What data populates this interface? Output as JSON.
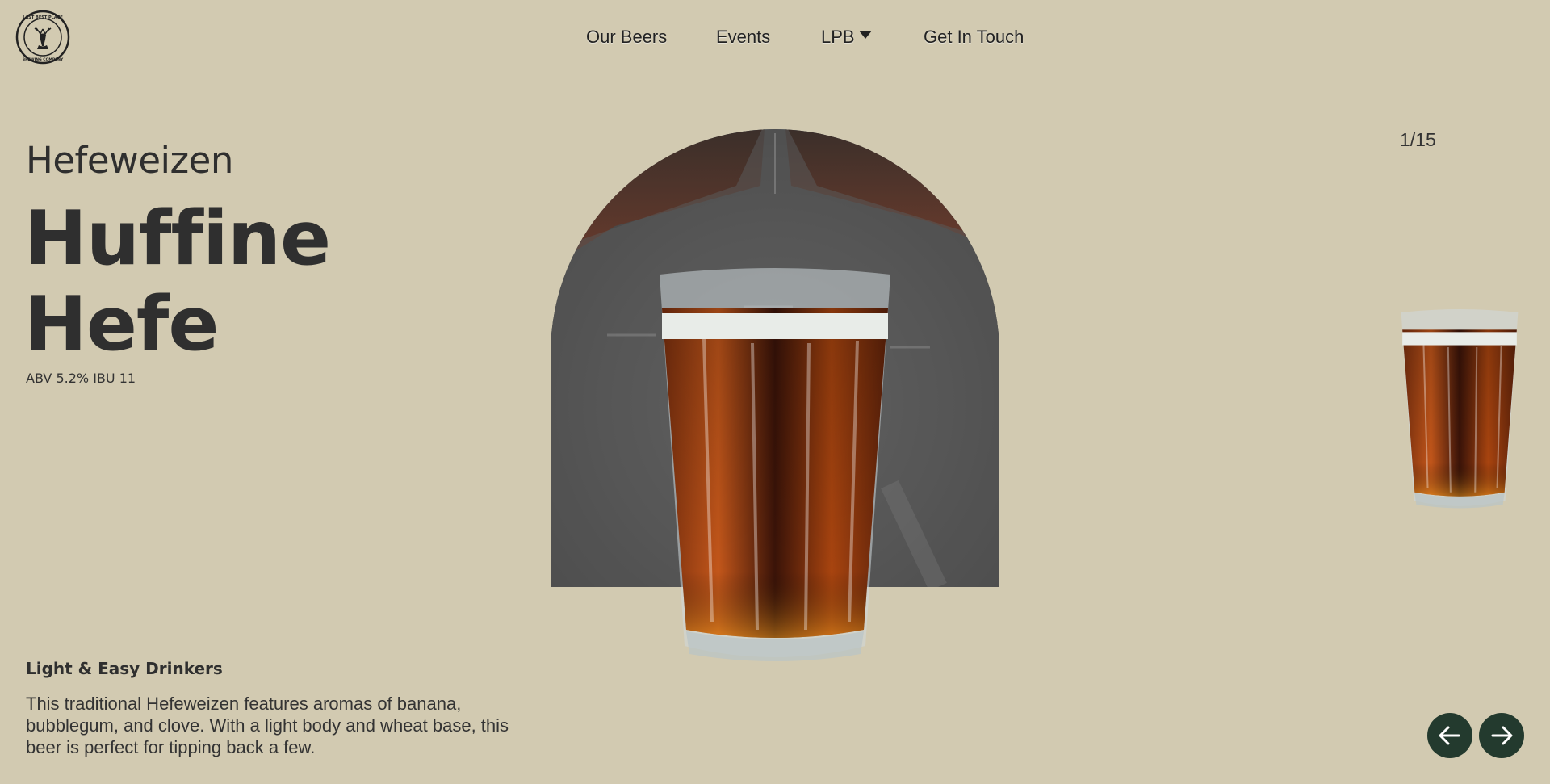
{
  "logo": {
    "text_top": "LAST BEST PLACE",
    "text_bottom": "BREWING COMPANY",
    "icon": "deer-icon"
  },
  "nav": {
    "our_beers": "Our Beers",
    "events": "Events",
    "lpb": "LPB",
    "get_in_touch": "Get In Touch"
  },
  "slider": {
    "counter": "1/15"
  },
  "beer": {
    "style": "Hefeweizen",
    "name_line1": "Huffine",
    "name_line2": "Hefe",
    "stats": "ABV 5.2% IBU 11",
    "category": "Light & Easy Drinkers",
    "description": "This traditional Hefeweizen features aromas of banana, bubblegum, and clove. With a light body and wheat base, this beer is perfect for tipping back a few."
  },
  "icons": {
    "prev": "arrow-left-icon",
    "next": "arrow-right-icon",
    "dropdown": "caret-down-icon"
  },
  "colors": {
    "background": "#d2cab1",
    "text": "#333333",
    "button": "#233a2e"
  }
}
